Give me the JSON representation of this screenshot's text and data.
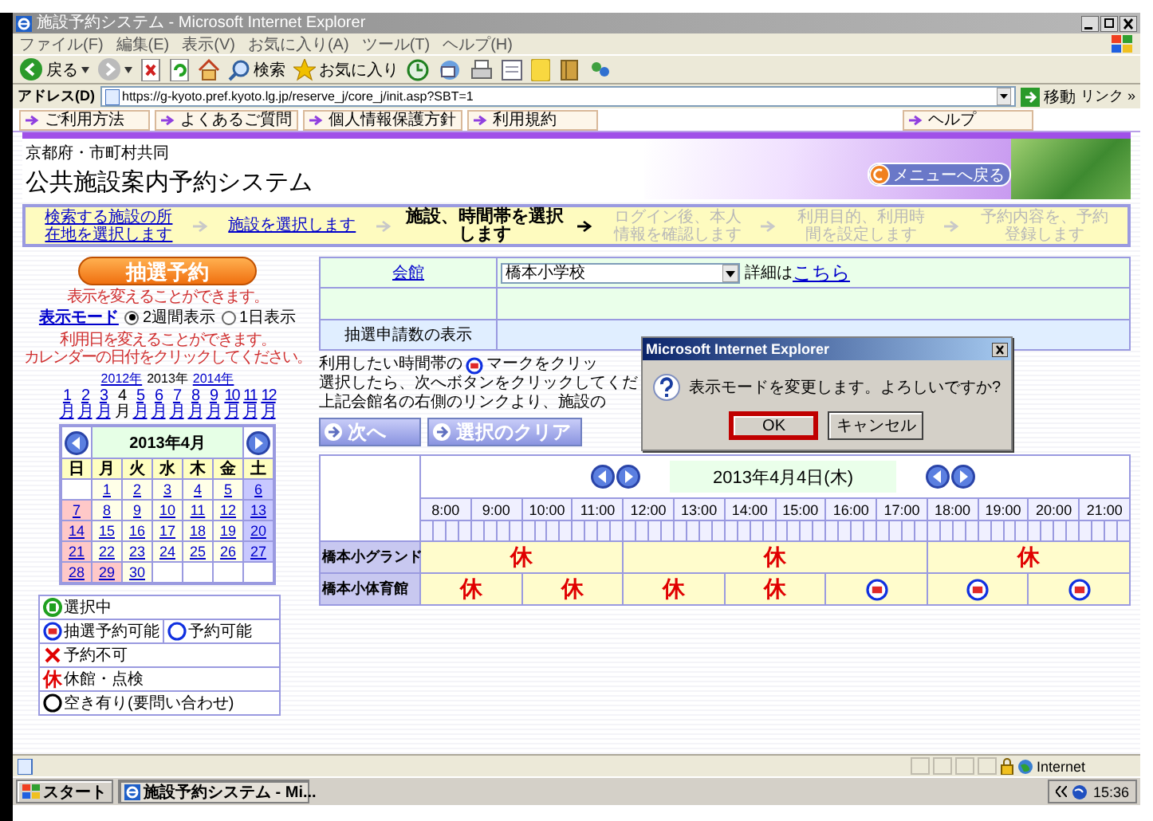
{
  "window": {
    "title": "施設予約システム - Microsoft Internet Explorer"
  },
  "menu": [
    "ファイル(F)",
    "編集(E)",
    "表示(V)",
    "お気に入り(A)",
    "ツール(T)",
    "ヘルプ(H)"
  ],
  "toolbar": {
    "back": "戻る",
    "search": "検索",
    "favorites": "お気に入り"
  },
  "address_bar": {
    "label": "アドレス(D)",
    "url": "https://g-kyoto.pref.kyoto.lg.jp/reserve_j/core_j/init.asp?SBT=1",
    "go": "移動",
    "links": "リンク »"
  },
  "link_bar": [
    {
      "label": "ご利用方法"
    },
    {
      "label": "よくあるご質問"
    },
    {
      "label": "個人情報保護方針"
    },
    {
      "label": "利用規約"
    },
    {
      "label": "ヘルプ"
    }
  ],
  "header": {
    "subtitle": "京都府・市町村共同",
    "title": "公共施設案内予約システム",
    "menu_button": "メニューへ戻る"
  },
  "steps": [
    {
      "label": "検索する施設の所在地を選択します",
      "kind": "done"
    },
    {
      "label": "施設を選択します",
      "kind": "done"
    },
    {
      "label": "施設、時間帯を選択します",
      "kind": "current"
    },
    {
      "label": "ログイン後、本人情報を確認します",
      "kind": "pending"
    },
    {
      "label": "利用目的、利用時間を設定します",
      "kind": "pending"
    },
    {
      "label": "予約内容を、予約登録します",
      "kind": "pending"
    }
  ],
  "left_panel": {
    "lottery_button": "抽選予約",
    "mode_hint": "表示を変えることができます。",
    "mode_label": "表示モード",
    "modes": [
      {
        "label": "2週間表示",
        "selected": true
      },
      {
        "label": "1日表示",
        "selected": false
      }
    ],
    "date_hint": [
      "利用日を変えることができます。",
      "カレンダーの日付をクリックしてください。"
    ],
    "years": [
      {
        "label": "2012年",
        "selected": false
      },
      {
        "label": "2013年",
        "selected": true
      },
      {
        "label": "2014年",
        "selected": false
      }
    ],
    "months": [
      {
        "label": "1月",
        "selected": false
      },
      {
        "label": "2月",
        "selected": false
      },
      {
        "label": "3月",
        "selected": false
      },
      {
        "label": "4月",
        "selected": true
      },
      {
        "label": "5月",
        "selected": false
      },
      {
        "label": "6月",
        "selected": false
      },
      {
        "label": "7月",
        "selected": false
      },
      {
        "label": "8月",
        "selected": false
      },
      {
        "label": "9月",
        "selected": false
      },
      {
        "label": "10月",
        "selected": false
      },
      {
        "label": "11月",
        "selected": false
      },
      {
        "label": "12月",
        "selected": false
      }
    ]
  },
  "calendar": {
    "title": "2013年4月",
    "weekdays": [
      "日",
      "月",
      "火",
      "水",
      "木",
      "金",
      "土"
    ],
    "weeks": [
      [
        {
          "kind": "blank"
        },
        {
          "day": "1",
          "kind": "weekday"
        },
        {
          "day": "2",
          "kind": "weekday"
        },
        {
          "day": "3",
          "kind": "weekday"
        },
        {
          "day": "4",
          "kind": "weekday"
        },
        {
          "day": "5",
          "kind": "weekday"
        },
        {
          "day": "6",
          "kind": "saturday"
        }
      ],
      [
        {
          "day": "7",
          "kind": "holiday"
        },
        {
          "day": "8",
          "kind": "weekday"
        },
        {
          "day": "9",
          "kind": "weekday"
        },
        {
          "day": "10",
          "kind": "weekday"
        },
        {
          "day": "11",
          "kind": "weekday"
        },
        {
          "day": "12",
          "kind": "weekday"
        },
        {
          "day": "13",
          "kind": "saturday"
        }
      ],
      [
        {
          "day": "14",
          "kind": "holiday"
        },
        {
          "day": "15",
          "kind": "weekday"
        },
        {
          "day": "16",
          "kind": "weekday"
        },
        {
          "day": "17",
          "kind": "weekday"
        },
        {
          "day": "18",
          "kind": "weekday"
        },
        {
          "day": "19",
          "kind": "weekday"
        },
        {
          "day": "20",
          "kind": "saturday"
        }
      ],
      [
        {
          "day": "21",
          "kind": "holiday"
        },
        {
          "day": "22",
          "kind": "weekday"
        },
        {
          "day": "23",
          "kind": "weekday"
        },
        {
          "day": "24",
          "kind": "weekday"
        },
        {
          "day": "25",
          "kind": "weekday"
        },
        {
          "day": "26",
          "kind": "weekday"
        },
        {
          "day": "27",
          "kind": "saturday"
        }
      ],
      [
        {
          "day": "28",
          "kind": "holiday"
        },
        {
          "day": "29",
          "kind": "holiday"
        },
        {
          "day": "30",
          "kind": "weekday"
        },
        {
          "kind": "blank"
        },
        {
          "kind": "blank"
        },
        {
          "kind": "blank"
        },
        {
          "kind": "blank"
        }
      ]
    ]
  },
  "legend": [
    [
      {
        "kind": "selected",
        "label": "選択中"
      }
    ],
    [
      {
        "kind": "lottery",
        "label": "抽選予約可能"
      },
      {
        "kind": "available",
        "label": "予約可能"
      }
    ],
    [
      {
        "kind": "unavailable",
        "label": "予約不可"
      }
    ],
    [
      {
        "kind": "closed",
        "mark": "休",
        "label": "休館・点検"
      }
    ],
    [
      {
        "kind": "inquiry",
        "label": "空き有り(要問い合わせ)"
      }
    ]
  ],
  "facility_form": {
    "hall_label": "会館",
    "hall_value": "橋本小学校",
    "detail_text": "詳細は",
    "detail_link": "こちら",
    "count_label": "抽選申請数の表示"
  },
  "instructions": {
    "line_1_before": "利用したい時間帯の",
    "line_1_after": "マークをクリッ",
    "line_2": "選択したら、次へボタンをクリックしてくだ",
    "line_3": "上記会館名の右側のリンクより、施設の"
  },
  "action_buttons": [
    {
      "label": "次へ"
    },
    {
      "label": "選択のクリア"
    }
  ],
  "schedule": {
    "date": "2013年4月4日(木)",
    "hours": [
      "8:00",
      "9:00",
      "10:00",
      "11:00",
      "12:00",
      "13:00",
      "14:00",
      "15:00",
      "16:00",
      "17:00",
      "18:00",
      "19:00",
      "20:00",
      "21:00"
    ],
    "rows": [
      {
        "name": "橋本小グランド",
        "slots": [
          {
            "kind": "closed",
            "mark": "休"
          },
          {
            "kind": "continued"
          },
          {
            "kind": "closed",
            "mark": "休"
          },
          {
            "kind": "continued"
          },
          {
            "kind": "continued"
          },
          {
            "kind": "closed",
            "mark": "休"
          },
          {
            "kind": "continued"
          }
        ]
      },
      {
        "name": "橋本小体育館",
        "slots": [
          {
            "kind": "closed",
            "mark": "休"
          },
          {
            "kind": "closed",
            "mark": "休"
          },
          {
            "kind": "closed",
            "mark": "休"
          },
          {
            "kind": "closed",
            "mark": "休"
          },
          {
            "kind": "lottery"
          },
          {
            "kind": "lottery"
          },
          {
            "kind": "lottery"
          }
        ]
      }
    ]
  },
  "dialog": {
    "title": "Microsoft Internet Explorer",
    "message": "表示モードを変更します。よろしいですか?",
    "buttons": [
      {
        "label": "OK",
        "highlighted": true
      },
      {
        "label": "キャンセル",
        "highlighted": false
      }
    ]
  },
  "status_bar": {
    "zone": "Internet"
  },
  "taskbar": {
    "start": "スタート",
    "task": "施設予約システム - Mi...",
    "clock": "15:36"
  }
}
